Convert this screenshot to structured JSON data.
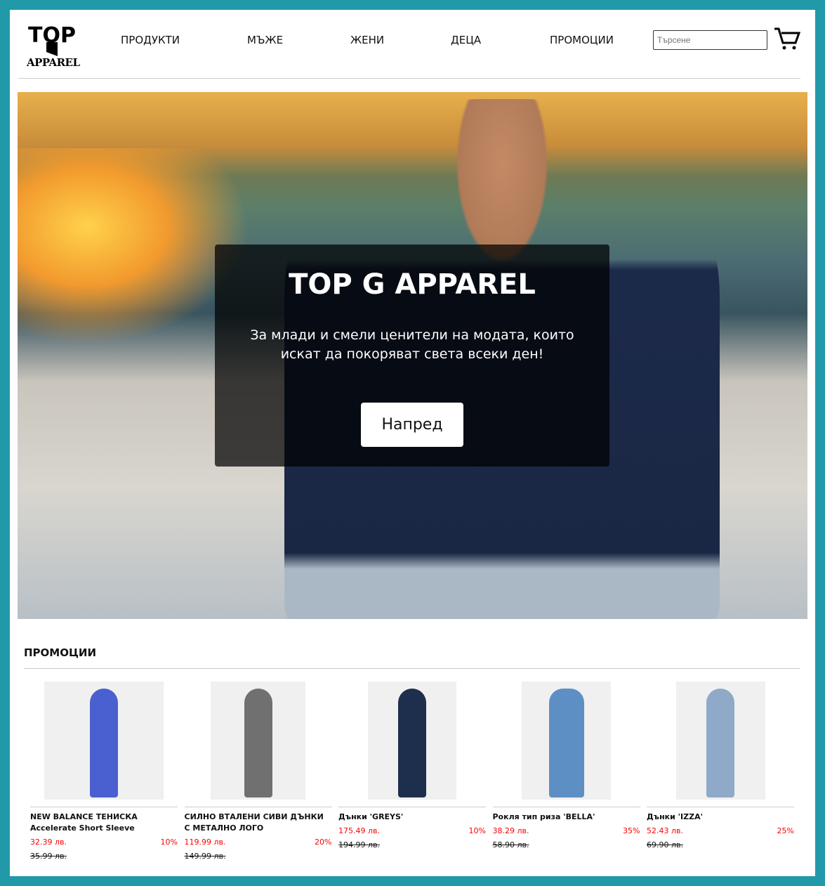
{
  "header": {
    "logo_text": "TOP G APPAREL",
    "nav": [
      "ПРОДУКТИ",
      "МЪЖЕ",
      "ЖЕНИ",
      "ДЕЦА",
      "ПРОМОЦИИ"
    ],
    "search_placeholder": "Търсене",
    "cart_icon": "shopping-cart-icon"
  },
  "hero": {
    "title": "TOP G APPAREL",
    "subtitle_line1": "За млади и смели ценители на модата, които",
    "subtitle_line2": "искат да покоряват света всеки ден!",
    "button": "Напред"
  },
  "promotions": {
    "title": "ПРОМОЦИИ",
    "products": [
      {
        "name": "NEW BALANCE ТЕНИСКА Accelerate Short Sleeve",
        "price": "32.39 лв.",
        "discount": "10%",
        "old_price": "35.99 лв.",
        "color": "#4a5fd0"
      },
      {
        "name": "СИЛНО ВТАЛЕНИ СИВИ ДЪНКИ С МЕТАЛНО ЛОГО",
        "price": "119.99 лв.",
        "discount": "20%",
        "old_price": "149.99 лв.",
        "color": "#707070"
      },
      {
        "name": "Дънки 'GREYS'",
        "price": "175.49 лв.",
        "discount": "10%",
        "old_price": "194.99 лв.",
        "color": "#1e2f4d"
      },
      {
        "name": "Рокля тип риза 'BELLA'",
        "price": "38.29 лв.",
        "discount": "35%",
        "old_price": "58.90 лв.",
        "color": "#5d8fc4"
      },
      {
        "name": "Дънки 'IZZA'",
        "price": "52.43 лв.",
        "discount": "25%",
        "old_price": "69.90 лв.",
        "color": "#8fa9c8"
      }
    ]
  }
}
